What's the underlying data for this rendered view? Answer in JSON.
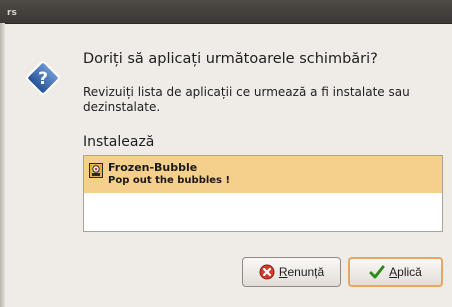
{
  "window": {
    "icon": "rs-app-icon"
  },
  "dialog": {
    "icon": "question-icon",
    "heading": "Doriți să aplicați următoarele schimbări?",
    "description": "Revizuiți lista de aplicații ce urmează a fi instalate sau dezinstalate."
  },
  "install_section": {
    "label": "Instalează",
    "items": [
      {
        "name": "Frozen-Bubble",
        "summary": "Pop out the bubbles !",
        "icon": "frozen-bubble-icon",
        "selected": true
      }
    ]
  },
  "buttons": {
    "cancel": {
      "mnemonic": "R",
      "rest": "enunță",
      "icon": "cancel-icon"
    },
    "apply": {
      "mnemonic": "A",
      "rest": "plică",
      "icon": "check-icon"
    }
  },
  "colors": {
    "selection": "#f5cf8c",
    "primary_border": "#e9a65c",
    "question_icon": "#3b6db3"
  }
}
